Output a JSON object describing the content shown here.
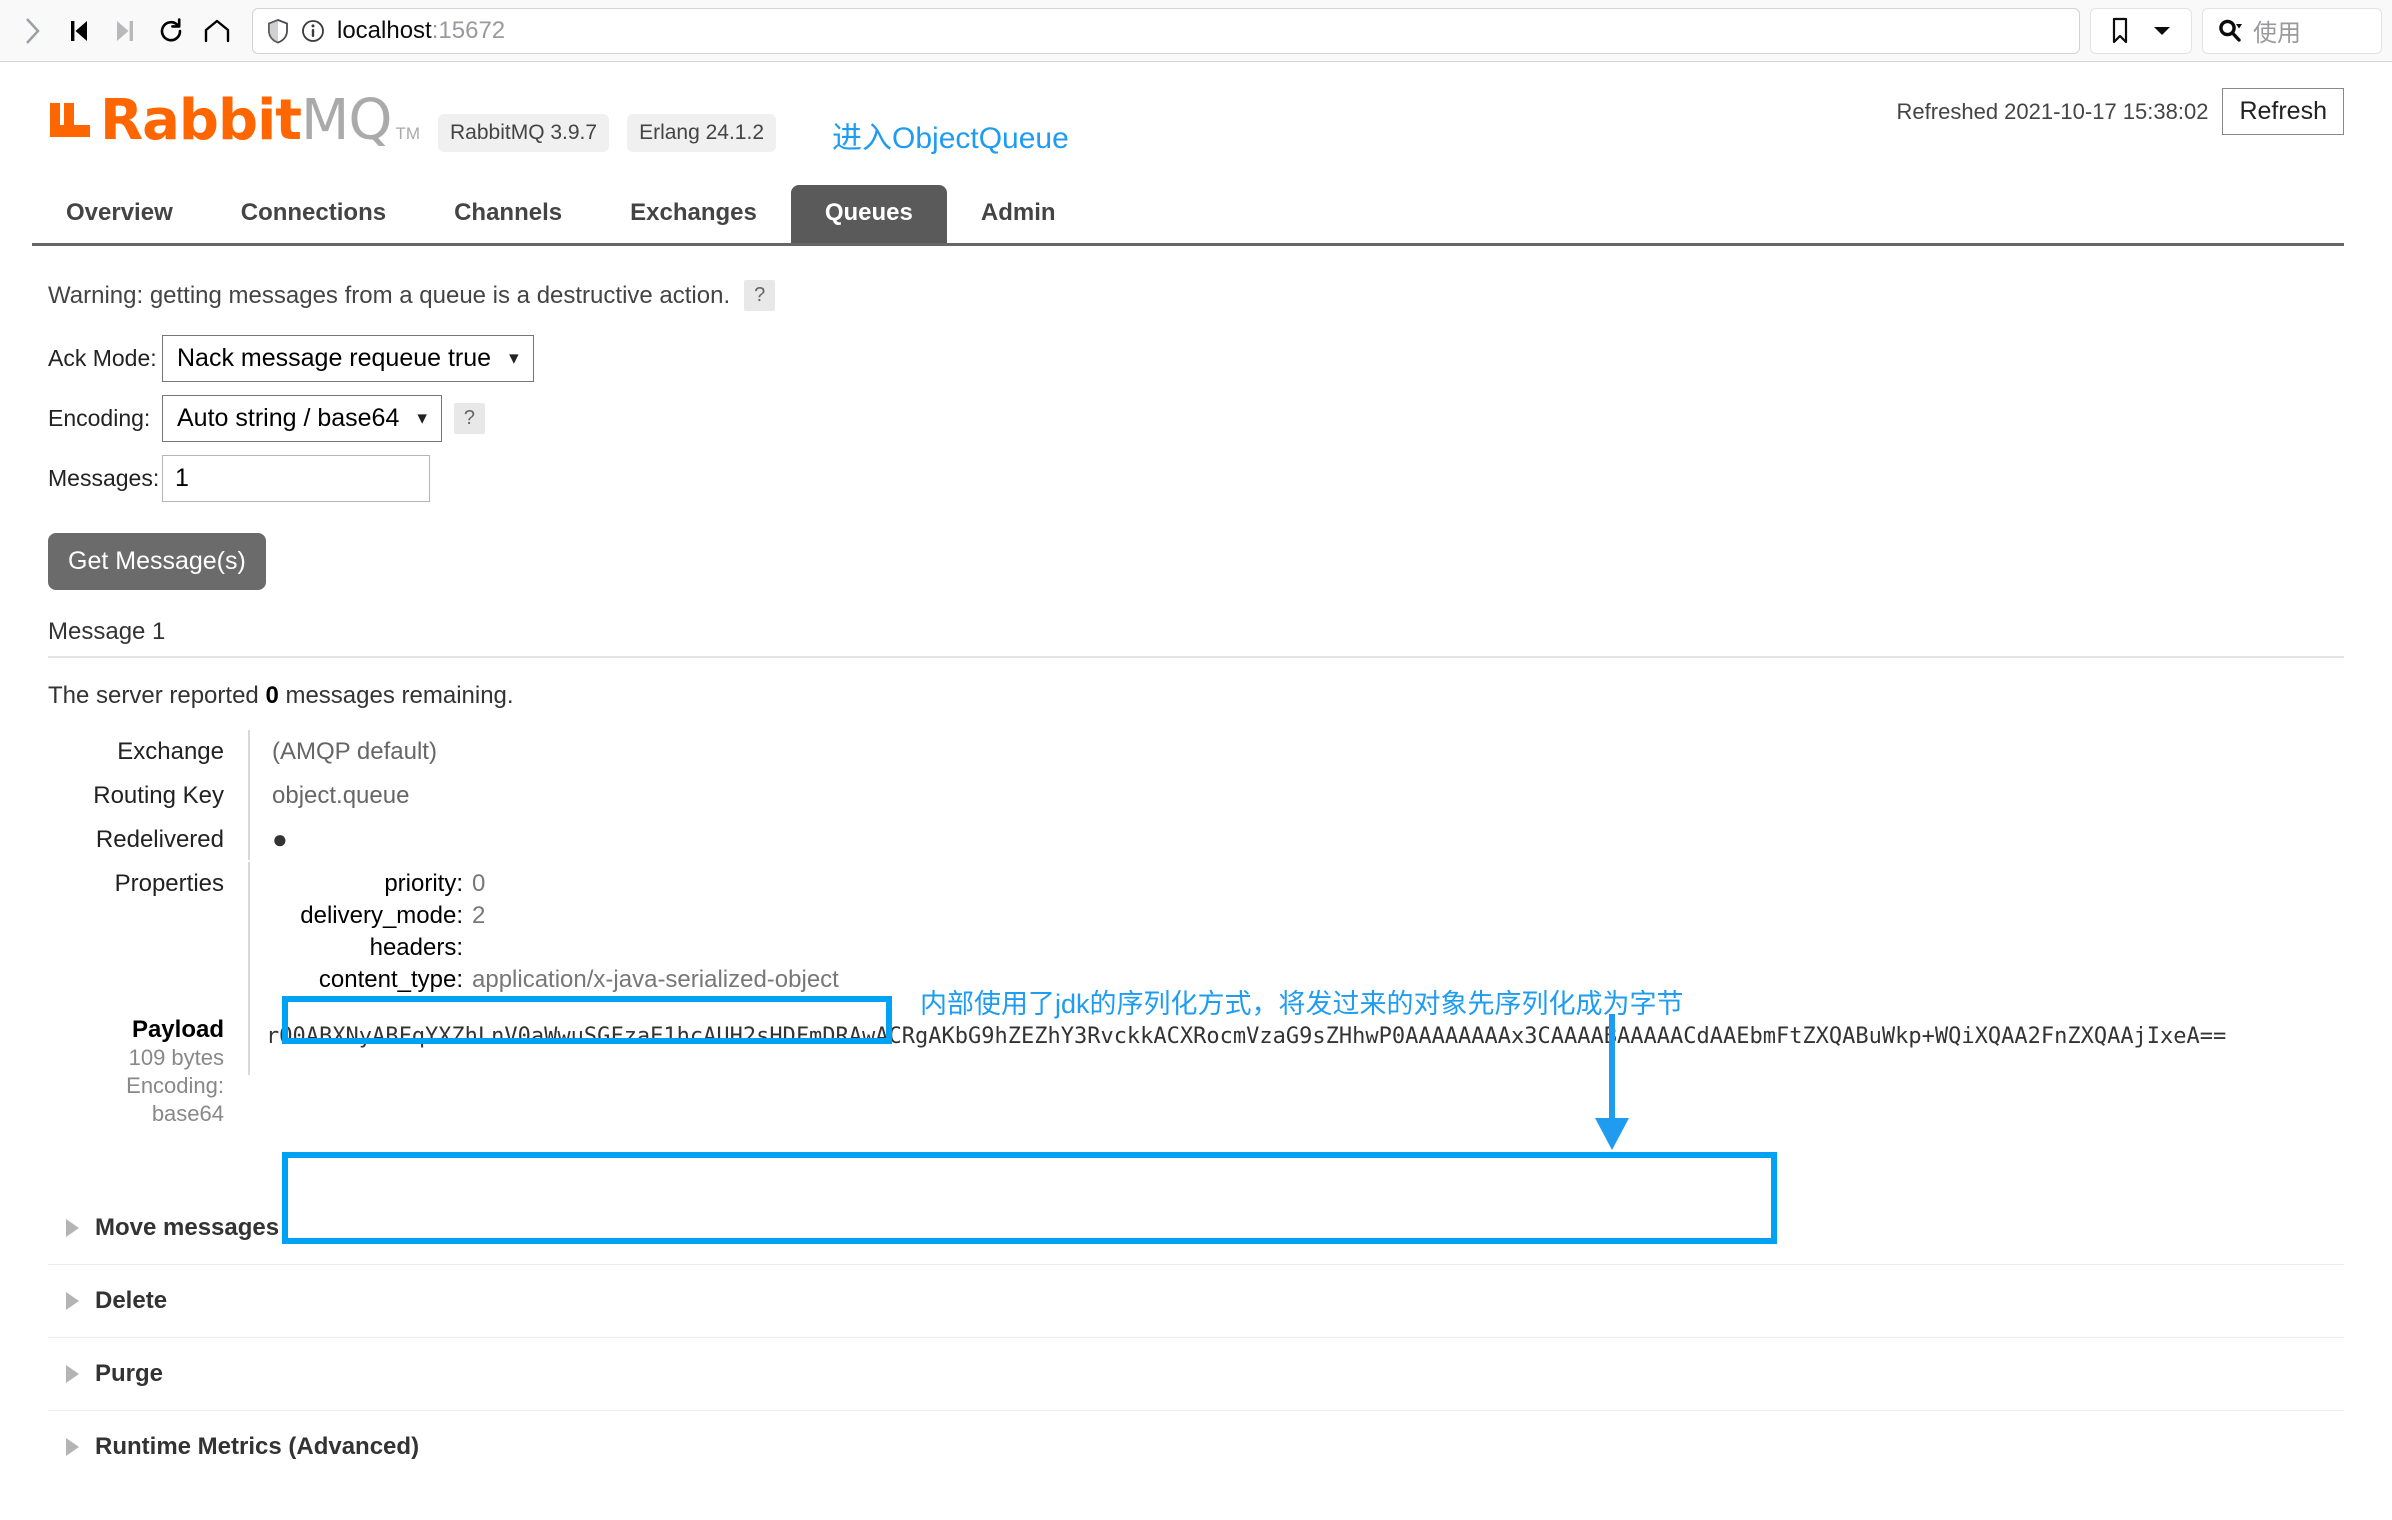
{
  "browser": {
    "url_host": "localhost",
    "url_port": ":15672",
    "search_placeholder": "使用",
    "icons": {
      "forward": "chevron-right-icon",
      "prev": "skip-back-icon",
      "next": "skip-forward-icon",
      "reload": "reload-icon",
      "home": "home-icon",
      "shield": "shield-icon",
      "info": "info-circle-icon",
      "bookmark": "bookmark-icon",
      "dropdown": "chevron-down-icon",
      "search": "search-icon"
    }
  },
  "header": {
    "logo_primary": "Rabbit",
    "logo_secondary": "MQ",
    "logo_tm": "TM",
    "badge_rabbitmq": "RabbitMQ 3.9.7",
    "badge_erlang": "Erlang 24.1.2",
    "annotation_link": "进入ObjectQueue",
    "refreshed": "Refreshed 2021-10-17 15:38:02",
    "refresh_button": "Refresh"
  },
  "tabs": [
    {
      "label": "Overview",
      "active": false
    },
    {
      "label": "Connections",
      "active": false
    },
    {
      "label": "Channels",
      "active": false
    },
    {
      "label": "Exchanges",
      "active": false
    },
    {
      "label": "Queues",
      "active": true
    },
    {
      "label": "Admin",
      "active": false
    }
  ],
  "warning": {
    "text": "Warning: getting messages from a queue is a destructive action.",
    "help": "?"
  },
  "form": {
    "ack_mode_label": "Ack Mode:",
    "ack_mode_value": "Nack message requeue true",
    "encoding_label": "Encoding:",
    "encoding_value": "Auto string / base64",
    "encoding_help": "?",
    "messages_label": "Messages:",
    "messages_value": "1",
    "get_messages_button": "Get Message(s)"
  },
  "message": {
    "heading": "Message 1",
    "server_report_prefix": "The server reported ",
    "server_report_count": "0",
    "server_report_suffix": " messages remaining.",
    "exchange_label": "Exchange",
    "exchange_value": "(AMQP default)",
    "routing_key_label": "Routing Key",
    "routing_key_value": "object.queue",
    "redelivered_label": "Redelivered",
    "redelivered_value": "●",
    "properties_label": "Properties",
    "properties": [
      {
        "key": "priority:",
        "value": "0"
      },
      {
        "key": "delivery_mode:",
        "value": "2"
      },
      {
        "key": "headers:",
        "value": ""
      },
      {
        "key": "content_type:",
        "value": "application/x-java-serialized-object"
      }
    ],
    "payload_label": "Payload",
    "payload_size": "109 bytes",
    "payload_encoding": "Encoding: base64",
    "payload_value": "rO0ABXNyABFqYXZhLnV0aWwuSGFzaE1hcAUH2sHDFmDRAwACRgAKbG9hZEZhY3RvckkACXRocmVzaG9sZHhwP0AAAAAAAAx3CAAAABAAAAACdAAEbmFtZXQABuWkp+WQiXQAA2FnZXQAAjIxeA=="
  },
  "annotation": {
    "note": "内部使用了jdk的序列化方式，将发过来的对象先序列化成为字节",
    "accent_color": "#00a2f3",
    "link_color": "#1f9cf0"
  },
  "accordion": [
    {
      "label": "Move messages"
    },
    {
      "label": "Delete"
    },
    {
      "label": "Purge"
    },
    {
      "label": "Runtime Metrics (Advanced)"
    }
  ]
}
